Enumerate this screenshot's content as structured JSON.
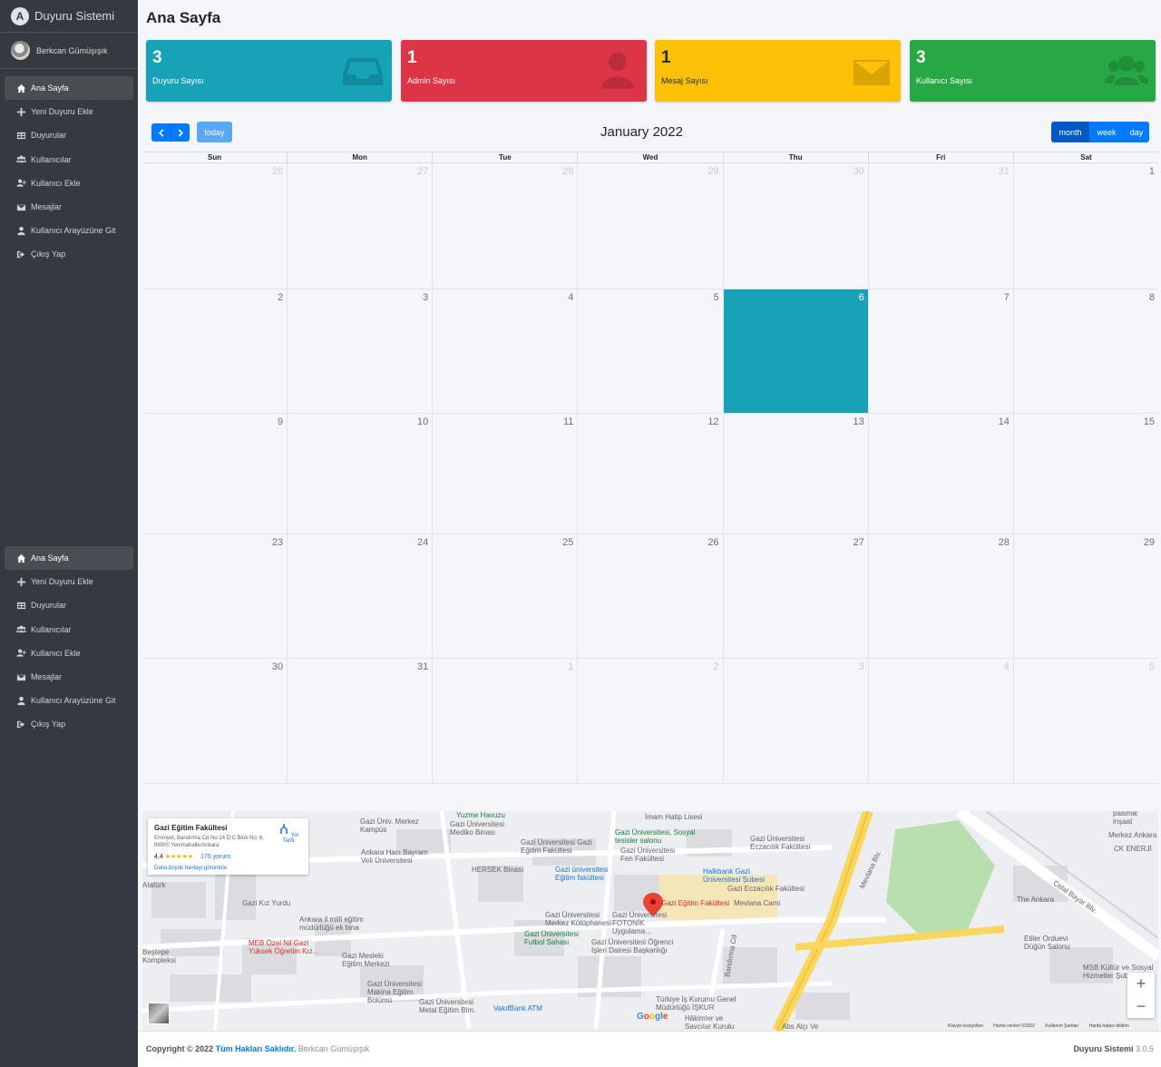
{
  "brand": {
    "title": "Duyuru Sistemi",
    "logo_letter": "A"
  },
  "user": {
    "name": "Berkcan Gümüşışık"
  },
  "nav": [
    {
      "label": "Ana Sayfa",
      "icon": "home-icon",
      "active": true
    },
    {
      "label": "Yeni Duyuru Ekle",
      "icon": "plus-icon"
    },
    {
      "label": "Duyurular",
      "icon": "table-icon"
    },
    {
      "label": "Kullanıcılar",
      "icon": "users-icon"
    },
    {
      "label": "Kullanıcı Ekle",
      "icon": "user-plus-icon"
    },
    {
      "label": "Mesajlar",
      "icon": "envelope-icon"
    },
    {
      "label": "Kullanıcı Arayüzüne Git",
      "icon": "user-icon"
    },
    {
      "label": "Çıkış Yap",
      "icon": "sign-out-icon"
    }
  ],
  "page": {
    "title": "Ana Sayfa"
  },
  "info_boxes": [
    {
      "count": "3",
      "label": "Duyuru Sayısı",
      "color": "#17a2b8",
      "icon": "inbox-icon",
      "text_color": "#ffffff"
    },
    {
      "count": "1",
      "label": "Admin Sayısı",
      "color": "#dc3545",
      "icon": "user-icon",
      "text_color": "#ffffff"
    },
    {
      "count": "1",
      "label": "Mesaj Sayısı",
      "color": "#ffc107",
      "icon": "envelope-icon",
      "text_color": "#1f2d3d"
    },
    {
      "count": "3",
      "label": "Kullanıcı Sayısı",
      "color": "#28a745",
      "icon": "users-icon",
      "text_color": "#ffffff"
    }
  ],
  "calendar": {
    "title": "January 2022",
    "today_label": "today",
    "views": {
      "month": "month",
      "week": "week",
      "day": "day"
    },
    "weekdays": [
      "Sun",
      "Mon",
      "Tue",
      "Wed",
      "Thu",
      "Fri",
      "Sat"
    ],
    "weeks": [
      [
        {
          "d": "26",
          "o": true
        },
        {
          "d": "27",
          "o": true
        },
        {
          "d": "28",
          "o": true
        },
        {
          "d": "29",
          "o": true
        },
        {
          "d": "30",
          "o": true
        },
        {
          "d": "31",
          "o": true
        },
        {
          "d": "1"
        }
      ],
      [
        {
          "d": "2"
        },
        {
          "d": "3"
        },
        {
          "d": "4"
        },
        {
          "d": "5"
        },
        {
          "d": "6",
          "t": true
        },
        {
          "d": "7"
        },
        {
          "d": "8"
        }
      ],
      [
        {
          "d": "9"
        },
        {
          "d": "10"
        },
        {
          "d": "11"
        },
        {
          "d": "12"
        },
        {
          "d": "13"
        },
        {
          "d": "14"
        },
        {
          "d": "15"
        }
      ],
      [
        {
          "d": "23"
        },
        {
          "d": "24"
        },
        {
          "d": "25"
        },
        {
          "d": "26"
        },
        {
          "d": "27"
        },
        {
          "d": "28"
        },
        {
          "d": "29"
        }
      ],
      [
        {
          "d": "30"
        },
        {
          "d": "31"
        },
        {
          "d": "1",
          "o": true
        },
        {
          "d": "2",
          "o": true
        },
        {
          "d": "3",
          "o": true
        },
        {
          "d": "4",
          "o": true
        },
        {
          "d": "5",
          "o": true
        }
      ]
    ],
    "today_color": "#17a2b8"
  },
  "map": {
    "place_name": "Gazi Eğitim Fakültesi",
    "address": "Emniyet, Bandırma Cd No:14 D:C Blok No: 6, 06500 Yenimahalle/Ankara",
    "rating": "4,4",
    "stars": "★★★★★",
    "reviews": "176 yorum",
    "larger_map": "Daha büyük haritayı görüntüle",
    "directions": "Yol Tarifi",
    "google": "Google",
    "labels": [
      "Gazi Eğitim Fakültesi",
      "Mevlana Cami",
      "Gazi Üniversitesi Merkez Kütüphanesi",
      "Gazi Üniversitesi FOTONİK Uygulama...",
      "Gazi Üniversitesi Futbol Sahası",
      "Gazi Üniversitesi Öğrenci İşleri Dairesi Başkanlığı",
      "Gazi Mesleki Eğitim Merkezi",
      "Gazi Üniversitesi Makina Eğitim Bölümü",
      "Gazi Üniversitesi Metal Eğitim Blm.",
      "MEB Özel Nil Gazi Yüksek Öğretim Kız...",
      "Ankara il milli eğitim müdürlüğü ek bina",
      "Gazi Kız Yurdu",
      "HERSEK Binası",
      "Gazi üniversitesi Eğitim fakültesi",
      "Gazi Üniversitesi Gazi Eğitim Fakültesi",
      "Gazi Üniversitesi Mediko Binası",
      "Yuzme Havuzu",
      "Gazi Üniversitesi, Sosyal tesisler salonu",
      "Gazi Üniversitesi Fen Fakültesi",
      "Halkbank Gazi Üniversitesi Şubesi",
      "Gazi Eczacılık Fakültesi",
      "Gazi Üniversitesi Eczacılık Fakültesi",
      "Ankara Hacı Bayram Veli Üniversitesi",
      "Gazi Üniv. Merkez Kampüs",
      "The Ankara",
      "Etiler Orduevi Düğün Salonu",
      "MSB Kültür ve Sosyal Hizmetler Şube M...",
      "Merkez Ankara",
      "CK ENERJİ",
      "Türkiye İş Kurumu Genel Müdürlüğü İŞKUR",
      "Hâkimler ve Savcılar Kurulu",
      "Abs Alçı Ve",
      "VakıfBank ATM",
      "Mevlana Blv.",
      "Bandırma Cd",
      "Celal Bayar Blv.",
      "İmam Hatip Lisesi",
      "pasimik inşaat",
      "Beştepe Kompleksi",
      "Atatürk"
    ],
    "footer": [
      "Klavye kısayolları",
      "Harita verileri ©2022",
      "Kullanım Şartları",
      "Harita hatası bildirin"
    ]
  },
  "footer": {
    "copyright": "Copyright © 2022",
    "rights": "Tüm Hakları Saklıdır.",
    "author": "Berkcan Gümüşışık",
    "app": "Duyuru Sistemi",
    "version": "3.0.5"
  }
}
